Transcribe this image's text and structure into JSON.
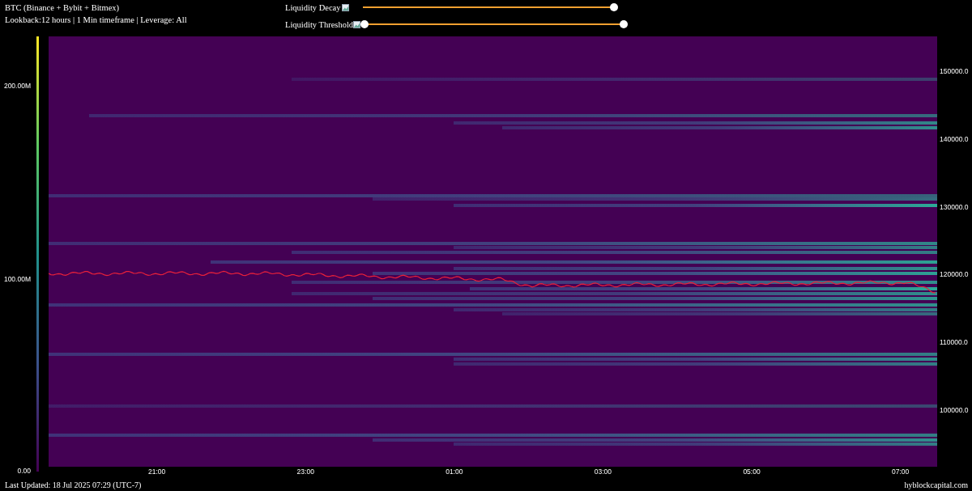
{
  "header": {
    "title": "BTC (Binance + Bybit + Bitmex)",
    "subtitle": "Lookback:12 hours | 1 Min timeframe | Leverage: All"
  },
  "sliders": [
    {
      "label": "Liquidity Decay",
      "thumbs": [
        {
          "level": 1
        }
      ]
    },
    {
      "label": "Liquidity Threshold",
      "thumbs": [
        {
          "level": 0
        },
        {
          "level": 1
        }
      ]
    }
  ],
  "colorbar": {
    "ticks": [
      "200.00M",
      "100.00M",
      "0.00"
    ]
  },
  "price_axis": {
    "ticks": [
      "150000.0",
      "140000.0",
      "130000.0",
      "120000.0",
      "110000.0",
      "100000.0"
    ]
  },
  "time_axis": {
    "ticks": [
      "21:00",
      "23:00",
      "01:00",
      "03:00",
      "05:00",
      "07:00"
    ]
  },
  "footer": {
    "updated": "Last Updated: 18 Jul 2025 07:29 (UTC-7)",
    "site": "hyblockcapital.com"
  }
}
